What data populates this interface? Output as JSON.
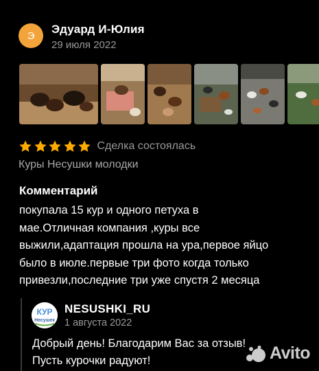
{
  "review": {
    "avatar_letter": "Э",
    "author": "Эдуард И-Юлия",
    "date": "29 июля 2022",
    "rating": 5,
    "status": "Сделка состоялась",
    "category": "Куры Несушки молодки",
    "comment_title": "Комментарий",
    "comment_lines": [
      "покупала 15 кур и одного петуха в",
      "мае.Отличная компания ,куры все",
      "выжили,адаптация прошла на ура,первое яйцо",
      "было в июле.первые три фото когда только",
      "привезли,последние три уже спустя 2 месяца"
    ]
  },
  "photos": [
    {
      "name": "photo-1",
      "bg": "#6b4a2c"
    },
    {
      "name": "photo-2",
      "bg": "#8a6a45"
    },
    {
      "name": "photo-3",
      "bg": "#7a5a3a"
    },
    {
      "name": "photo-4",
      "bg": "#5f6b55"
    },
    {
      "name": "photo-5",
      "bg": "#6e6e66"
    },
    {
      "name": "photo-6",
      "bg": "#4f6d3e"
    }
  ],
  "seller": {
    "logo_text_top": "КУР",
    "logo_text_bottom": "Несушек",
    "name": "NESUSHKI_RU",
    "date": "1 августа 2022",
    "reply_lines": [
      "Добрый день! Благодарим Вас за отзыв!",
      "Пусть курочки радуют!"
    ]
  },
  "watermark": {
    "text": "Avito"
  },
  "colors": {
    "star": "#ffab00",
    "avatar": "#f2a43a",
    "muted": "#9a9a9a"
  }
}
